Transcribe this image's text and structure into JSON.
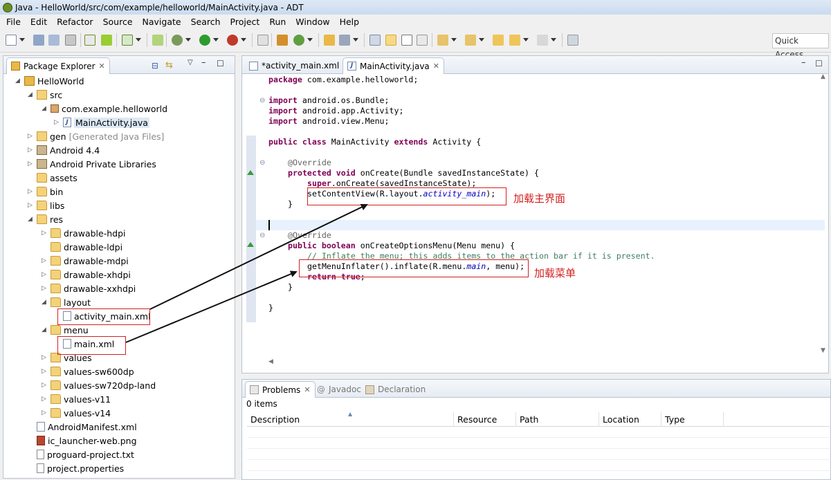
{
  "window": {
    "title": "Java - HelloWorld/src/com/example/helloworld/MainActivity.java - ADT"
  },
  "menu": [
    "File",
    "Edit",
    "Refactor",
    "Source",
    "Navigate",
    "Search",
    "Project",
    "Run",
    "Window",
    "Help"
  ],
  "toolbar": {
    "quick_access": "Quick Access"
  },
  "package_explorer": {
    "title": "Package Explorer",
    "tree": [
      {
        "label": "HelloWorld",
        "icon": "project-icon",
        "depth": 0,
        "expanded": true
      },
      {
        "label": "src",
        "icon": "source-folder-icon",
        "depth": 1,
        "expanded": true
      },
      {
        "label": "com.example.helloworld",
        "icon": "package-icon",
        "depth": 2,
        "expanded": true
      },
      {
        "label": "MainActivity.java",
        "icon": "java-file-icon",
        "depth": 3,
        "expanded": false
      },
      {
        "label": "gen",
        "suffix": "[Generated Java Files]",
        "icon": "source-folder-icon",
        "depth": 1,
        "expanded": false
      },
      {
        "label": "Android 4.4",
        "icon": "library-icon",
        "depth": 1,
        "expanded": false
      },
      {
        "label": "Android Private Libraries",
        "icon": "library-icon",
        "depth": 1,
        "expanded": false
      },
      {
        "label": "assets",
        "icon": "folder-icon",
        "depth": 1,
        "expanded": null
      },
      {
        "label": "bin",
        "icon": "folder-icon",
        "depth": 1,
        "expanded": false
      },
      {
        "label": "libs",
        "icon": "folder-icon",
        "depth": 1,
        "expanded": false
      },
      {
        "label": "res",
        "icon": "folder-icon",
        "depth": 1,
        "expanded": true
      },
      {
        "label": "drawable-hdpi",
        "icon": "folder-icon",
        "depth": 2,
        "expanded": false
      },
      {
        "label": "drawable-ldpi",
        "icon": "folder-icon",
        "depth": 2,
        "expanded": null
      },
      {
        "label": "drawable-mdpi",
        "icon": "folder-icon",
        "depth": 2,
        "expanded": false
      },
      {
        "label": "drawable-xhdpi",
        "icon": "folder-icon",
        "depth": 2,
        "expanded": false
      },
      {
        "label": "drawable-xxhdpi",
        "icon": "folder-icon",
        "depth": 2,
        "expanded": false
      },
      {
        "label": "layout",
        "icon": "folder-icon",
        "depth": 2,
        "expanded": true
      },
      {
        "label": "activity_main.xml",
        "icon": "xml-file-icon",
        "depth": 3,
        "expanded": null
      },
      {
        "label": "menu",
        "icon": "folder-icon",
        "depth": 2,
        "expanded": true
      },
      {
        "label": "main.xml",
        "icon": "xml-file-icon",
        "depth": 3,
        "expanded": null
      },
      {
        "label": "values",
        "icon": "folder-icon",
        "depth": 2,
        "expanded": false
      },
      {
        "label": "values-sw600dp",
        "icon": "folder-icon",
        "depth": 2,
        "expanded": false
      },
      {
        "label": "values-sw720dp-land",
        "icon": "folder-icon",
        "depth": 2,
        "expanded": false
      },
      {
        "label": "values-v11",
        "icon": "folder-icon",
        "depth": 2,
        "expanded": false
      },
      {
        "label": "values-v14",
        "icon": "folder-icon",
        "depth": 2,
        "expanded": false
      },
      {
        "label": "AndroidManifest.xml",
        "icon": "xml-file-icon",
        "depth": 1,
        "expanded": null
      },
      {
        "label": "ic_launcher-web.png",
        "icon": "png-file-icon",
        "depth": 1,
        "expanded": null
      },
      {
        "label": "proguard-project.txt",
        "icon": "text-file-icon",
        "depth": 1,
        "expanded": null
      },
      {
        "label": "project.properties",
        "icon": "text-file-icon",
        "depth": 1,
        "expanded": null
      }
    ]
  },
  "editor": {
    "tabs": [
      {
        "label": "*activity_main.xml",
        "active": false
      },
      {
        "label": "MainActivity.java",
        "active": true
      }
    ],
    "code": {
      "package_kw": "package",
      "package_name": " com.example.helloworld;",
      "import1_kw": "import",
      "import1": " android.os.Bundle;",
      "import2_kw": "import",
      "import2": " android.app.Activity;",
      "import3_kw": "import",
      "import3": " android.view.Menu;",
      "class_public": "public",
      "class_kw": " class",
      "class_name": " MainActivity ",
      "class_extends": "extends",
      "class_parent": " Activity {",
      "override1": "@Override",
      "oncreate_protected": "protected",
      "oncreate_void": " void",
      "oncreate_sig": " onCreate(Bundle savedInstanceState) {",
      "super_kw": "super",
      "super_call": ".onCreate(savedInstanceState);",
      "setcontent_a": "setContentView(R.layout.",
      "setcontent_it": "activity_main",
      "setcontent_b": ");",
      "close1": "}",
      "override2": "@Override",
      "menu_public": "public",
      "menu_boolean": " boolean",
      "menu_sig": " onCreateOptionsMenu(Menu menu) {",
      "comment": "// Inflate the menu; this adds items to the action bar if it is present.",
      "inflate_a": "getMenuInflater().inflate(R.menu.",
      "inflate_it": "main",
      "inflate_b": ", menu);",
      "return_kw": "return",
      "return_true": " true",
      "return_end": ";",
      "close2": "}",
      "close3": "}"
    },
    "annotations": {
      "load_main_ui": "加载主界面",
      "load_menu": "加载菜单"
    }
  },
  "bottom": {
    "tabs": [
      {
        "label": "Problems",
        "active": true
      },
      {
        "label": "Javadoc",
        "active": false
      },
      {
        "label": "Declaration",
        "active": false
      }
    ],
    "count": "0 items",
    "columns": [
      "Description",
      "Resource",
      "Path",
      "Location",
      "Type"
    ]
  },
  "colors": {
    "keyword": "#7f0055",
    "comment": "#3f7f5f",
    "annotation_red": "#d42020",
    "field_italic": "#0000c0"
  }
}
